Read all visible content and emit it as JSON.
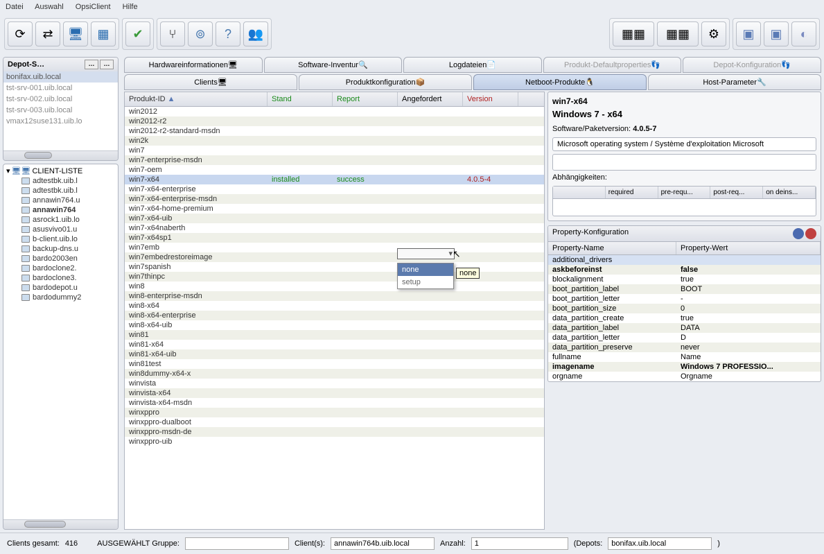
{
  "menu": {
    "datei": "Datei",
    "auswahl": "Auswahl",
    "opsiclient": "OpsiClient",
    "hilfe": "Hilfe"
  },
  "left": {
    "depot_title": "Depot-S…",
    "depots": [
      "bonifax.uib.local",
      "tst-srv-001.uib.local",
      "tst-srv-002.uib.local",
      "tst-srv-003.uib.local",
      "vmax12suse131.uib.lo"
    ],
    "client_title": "CLIENT-LISTE",
    "clients": [
      "adtestbk.uib.l",
      "adtestbk.uib.l",
      "annawin764.u",
      "annawin764",
      "asrock1.uib.lo",
      "asusvivo01.u",
      "b-client.uib.lo",
      "backup-dns.u",
      "bardo2003en",
      "bardoclone2.",
      "bardoclone3.",
      "bardodepot.u",
      "bardodummy2"
    ],
    "client_bold_idx": 3
  },
  "tabs1": {
    "hw": "Hardwareinformationen",
    "sw": "Software-Inventur",
    "log": "Logdateien",
    "pdef": "Produkt-Defaultproperties",
    "dconf": "Depot-Konfiguration"
  },
  "tabs2": {
    "clients": "Clients",
    "pconf": "Produktkonfiguration",
    "netboot": "Netboot-Produkte",
    "hostp": "Host-Parameter"
  },
  "cols": {
    "id": "Produkt-ID",
    "stand": "Stand",
    "report": "Report",
    "angef": "Angefordert",
    "version": "Version"
  },
  "products": [
    {
      "id": "win2012"
    },
    {
      "id": "win2012-r2"
    },
    {
      "id": "win2012-r2-standard-msdn"
    },
    {
      "id": "win2k"
    },
    {
      "id": "win7"
    },
    {
      "id": "win7-enterprise-msdn"
    },
    {
      "id": "win7-oem"
    },
    {
      "id": "win7-x64",
      "stand": "installed",
      "report": "success",
      "version": "4.0.5-4",
      "sel": true
    },
    {
      "id": "win7-x64-enterprise"
    },
    {
      "id": "win7-x64-enterprise-msdn"
    },
    {
      "id": "win7-x64-home-premium"
    },
    {
      "id": "win7-x64-uib"
    },
    {
      "id": "win7-x64naberth"
    },
    {
      "id": "win7-x64sp1"
    },
    {
      "id": "win7emb"
    },
    {
      "id": "win7embedrestoreimage"
    },
    {
      "id": "win7spanish"
    },
    {
      "id": "win7thinpc"
    },
    {
      "id": "win8"
    },
    {
      "id": "win8-enterprise-msdn"
    },
    {
      "id": "win8-x64"
    },
    {
      "id": "win8-x64-enterprise"
    },
    {
      "id": "win8-x64-uib"
    },
    {
      "id": "win81"
    },
    {
      "id": "win81-x64"
    },
    {
      "id": "win81-x64-uib"
    },
    {
      "id": "win81test"
    },
    {
      "id": "win8dummy-x64-x"
    },
    {
      "id": "winvista"
    },
    {
      "id": "winvista-x64"
    },
    {
      "id": "winvista-x64-msdn"
    },
    {
      "id": "winxppro"
    },
    {
      "id": "winxppro-dualboot"
    },
    {
      "id": "winxppro-msdn-de"
    },
    {
      "id": "winxppro-uib"
    }
  ],
  "dropdown": {
    "opt1": "none",
    "opt2": "setup",
    "tooltip": "none"
  },
  "detail": {
    "id": "win7-x64",
    "title": "Windows 7 - x64",
    "ver_label": "Software/Paketversion:",
    "ver": "4.0.5-7",
    "desc": "Microsoft operating system / Système d'exploitation Microsoft",
    "dep_label": "Abhängigkeiten:",
    "dep_cols": {
      "c1": "",
      "c2": "required",
      "c3": "pre-requ...",
      "c4": "post-req...",
      "c5": "on deins..."
    },
    "prop_title": "Property-Konfiguration",
    "prop_cols": {
      "name": "Property-Name",
      "wert": "Property-Wert"
    },
    "props": [
      {
        "n": "additional_drivers",
        "v": "",
        "sel": true
      },
      {
        "n": "askbeforeinst",
        "v": "false",
        "bold": true
      },
      {
        "n": "blockalignment",
        "v": "true"
      },
      {
        "n": "boot_partition_label",
        "v": "BOOT"
      },
      {
        "n": "boot_partition_letter",
        "v": "-"
      },
      {
        "n": "boot_partition_size",
        "v": "0"
      },
      {
        "n": "data_partition_create",
        "v": "true"
      },
      {
        "n": "data_partition_label",
        "v": "DATA"
      },
      {
        "n": "data_partition_letter",
        "v": "D"
      },
      {
        "n": "data_partition_preserve",
        "v": "never"
      },
      {
        "n": "fullname",
        "v": "Name"
      },
      {
        "n": "imagename",
        "v": "Windows 7 PROFESSIO...",
        "bold": true
      },
      {
        "n": "orgname",
        "v": "Orgname"
      }
    ]
  },
  "status": {
    "clients_gesamt_lbl": "Clients gesamt:",
    "clients_gesamt": "416",
    "ausgewaehlt": "AUSGEWÄHLT Gruppe:",
    "clients_lbl": "Client(s):",
    "clients_val": "annawin764b.uib.local",
    "anzahl_lbl": "Anzahl:",
    "anzahl": "1",
    "depots_lbl": "(Depots:",
    "depots_val": "bonifax.uib.local"
  }
}
